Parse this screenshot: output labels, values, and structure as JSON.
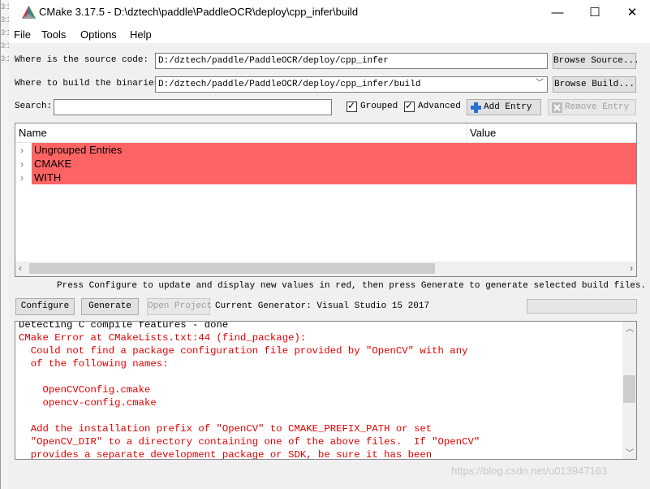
{
  "window": {
    "title": "CMake 3.17.5 - D:\\dztech\\paddle\\PaddleOCR\\deploy\\cpp_infer\\build",
    "controls": {
      "minimize": "—",
      "maximize": "☐",
      "close": "✕"
    }
  },
  "left_strip": [
    "3:17.5",
    "3:17.5",
    "3:17.5",
    "3:17.5",
    "3:17.5"
  ],
  "menu": {
    "file": "File",
    "tools": "Tools",
    "options": "Options",
    "help": "Help"
  },
  "source": {
    "label": "Where is the source code:",
    "value": "D:/dztech/paddle/PaddleOCR/deploy/cpp_infer",
    "browse_label": "Browse Source..."
  },
  "build": {
    "label": "Where to build the binaries:",
    "value": "D:/dztech/paddle/PaddleOCR/deploy/cpp_infer/build",
    "browse_label": "Browse Build..."
  },
  "search": {
    "label": "Search:",
    "value": "",
    "grouped_label": "Grouped",
    "grouped_checked": true,
    "advanced_label": "Advanced",
    "advanced_checked": true,
    "add_entry_label": "Add Entry",
    "remove_entry_label": "Remove Entry"
  },
  "table": {
    "columns": {
      "name": "Name",
      "value": "Value"
    },
    "rows": [
      "Ungrouped Entries",
      "CMAKE",
      "WITH"
    ],
    "row_color": "#ff6464"
  },
  "info_line": "Press Configure to update and display new values in red, then press Generate to generate selected build files.",
  "actions": {
    "configure": "Configure",
    "generate": "Generate",
    "open_project": "Open Project",
    "current_generator": "Current Generator: Visual Studio 15 2017"
  },
  "output": {
    "lines": [
      "Detecting C compile features - done",
      "CMake Error at CMakeLists.txt:44 (find_package):",
      "  Could not find a package configuration file provided by \"OpenCV\" with any",
      "  of the following names:",
      "",
      "    OpenCVConfig.cmake",
      "    opencv-config.cmake",
      "",
      "  Add the installation prefix of \"OpenCV\" to CMAKE_PREFIX_PATH or set",
      "  \"OpenCV_DIR\" to a directory containing one of the above files.  If \"OpenCV\"",
      "  provides a separate development package or SDK, be sure it has been"
    ],
    "error_color": "#e00000"
  },
  "watermark": "https://blog.csdn.net/u013947163"
}
